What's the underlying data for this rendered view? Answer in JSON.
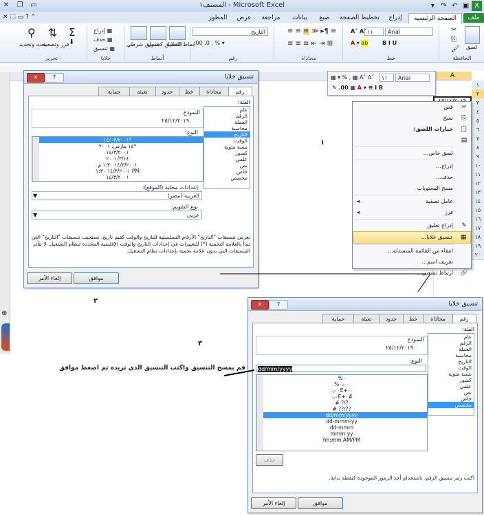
{
  "window": {
    "title": "المصنف١ - Microsoft Excel",
    "qat_icons": [
      "excel-logo-icon",
      "save-icon",
      "undo-icon",
      "redo-icon",
      "customize-icon"
    ],
    "controls": [
      "minimize-icon",
      "restore-icon",
      "close-icon"
    ]
  },
  "ribbon_tabs": {
    "file": "ملف",
    "home": "الصفحة الرئيسية",
    "insert": "إدراج",
    "page_layout": "تخطيط الصفحة",
    "formulas": "صيغ",
    "data": "بيانات",
    "review": "مراجعة",
    "view": "عرض",
    "developer": "المطور"
  },
  "ribbon": {
    "clipboard_label": "الحافظة",
    "paste": "لصق",
    "font_label": "خط",
    "font_name": "Arial",
    "font_size": "١١",
    "alignment_label": "محاذاة",
    "number_label": "رقم",
    "number_format": "التاريخ",
    "styles_label": "أنماط",
    "conditional": "تنسيق شرطي",
    "format_table": "التنسيق كجدول",
    "cell_styles": "أنماط الخلايا",
    "cells_label": "خلايا",
    "insert_cell": "إدراج",
    "delete_cell": "حذف",
    "format_cell": "تنسيق",
    "editing_label": "تحرير",
    "sort_filter": "فرز وتصفية",
    "find_select": "بحث وتحديد"
  },
  "sheet": {
    "column_a": "A",
    "selected_value": "٢٥/١٢/٢٠١٩",
    "row_numbers": [
      "١",
      "٢",
      "٣",
      "٤",
      "٥",
      "٦",
      "٧",
      "٨",
      "٩",
      "١٠",
      "١١",
      "١٢",
      "١٣",
      "١٤",
      "١٥",
      "١٦",
      "١٧",
      "١٨",
      "١٩",
      "٢٠"
    ]
  },
  "mini_toolbar": {
    "font": "Arial",
    "size": "١١"
  },
  "context_menu": {
    "items": [
      {
        "label": "قص",
        "icon": "scissors-icon"
      },
      {
        "label": "نسخ",
        "icon": "copy-icon"
      },
      {
        "label": "خيارات اللصق:",
        "icon": "paste-icon",
        "bold": true
      },
      {
        "label": "",
        "icon": "paste-values-icon"
      },
      {
        "label": "لصق خاص...",
        "icon": ""
      },
      {
        "label": "إدراج...",
        "icon": ""
      },
      {
        "label": "حذف...",
        "icon": ""
      },
      {
        "label": "مسح المحتويات",
        "icon": ""
      },
      {
        "label": "عامل تصفية",
        "icon": "",
        "arrow": true
      },
      {
        "label": "فرز",
        "icon": "",
        "arrow": true
      },
      {
        "label": "إدراج تعليق",
        "icon": "comment-icon"
      },
      {
        "label": "تنسيق خلايا...",
        "icon": "format-cells-icon",
        "highlight": true
      },
      {
        "label": "انتقاء من القائمة المنسدلة...",
        "icon": ""
      },
      {
        "label": "تعريف اسم...",
        "icon": ""
      },
      {
        "label": "ارتباط تشعبي...",
        "icon": "hyperlink-icon"
      }
    ]
  },
  "annotations": {
    "step1": "١",
    "step2": "٢",
    "step3": "٣",
    "instruction": "قم بمسح التنسيق واكتب التنسيق الذي تريده ثم اضغط موافق"
  },
  "dialog1": {
    "title": "تنسيق خلايا",
    "tabs": [
      "رقم",
      "محاذاة",
      "خط",
      "حدود",
      "تعبئة",
      "حماية"
    ],
    "category_label": "الفئة:",
    "categories": [
      "عام",
      "الرقم",
      "العملة",
      "محاسبة",
      "التاريخ",
      "الوقت",
      "نسبة مئوية",
      "كسور",
      "علمي",
      "نص",
      "خاص",
      "مخصص"
    ],
    "selected_category": 4,
    "sample_label": "النموذج",
    "sample_value": "٢٥/١٢/٢٠١٩",
    "type_label": "النوع:",
    "types": [
      "١٤/٠٣/٢٠٠١*",
      "١٤ مارس، ٢٠٠١*",
      "١٤/٣/٢٠٠١",
      "٢٠٠١/٣/١٤",
      "١٤/٣/٢٠٠١ ١:٣٠ م",
      "١٤/٣/٢٠٠١ ١:٣٠ PM",
      "١٤/٣/٢٠٠١"
    ],
    "selected_type": 0,
    "locale_label": "إعدادات محلية (الموقع):",
    "locale_value": "العربية (مصر)",
    "calendar_label": "نوع التقويم:",
    "calendar_value": "عربي",
    "description": "تعرض تنسيقات \"التاريخ\" الأرقام التسلسلية للتاريخ والوقت كقيم تاريخ. تستجيب تنسيقات \"التاريخ\" التي تبدأ بالعلامة النجمية (*) للتغييرات في إعدادات التاريخ والوقت الإقليمية المحددة لنظام التشغيل. لا تتأثر التنسيقات التي بدون علامة نجمية بإعدادات نظام التشغيل.",
    "ok": "موافق",
    "cancel": "إلغاء الأمر"
  },
  "dialog2": {
    "title": "تنسيق خلايا",
    "tabs": [
      "رقم",
      "محاذاة",
      "خط",
      "حدود",
      "تعبئة",
      "حماية"
    ],
    "category_label": "الفئة:",
    "categories": [
      "عام",
      "الرقم",
      "العملة",
      "محاسبة",
      "التاريخ",
      "الوقت",
      "نسبة مئوية",
      "كسور",
      "علمي",
      "نص",
      "خاص",
      "مخصص"
    ],
    "selected_category": 11,
    "sample_label": "النموذج",
    "sample_value": "٢٥/١٢/٢٠١٩",
    "type_label": "النوع:",
    "type_value": "dd/mm/yyyy",
    "types": [
      "%٠",
      "%٠٫٠٠",
      "٠٫٠٠E+٠٠",
      "٠٫٠E+٠#",
      "# ?/?",
      "# ??/??",
      "dd/mm/yyyy",
      "dd-mmm-yy",
      "dd-mmm",
      "mmm yy",
      "hh:mm AM/PM"
    ],
    "selected_type": 6,
    "delete": "حذف",
    "description": "اكتب رمز تنسيق الرقم، باستخدام أحد الرموز الموجودة كنقطة بداية.",
    "ok": "موافق",
    "cancel": "إلغاء الأمر"
  },
  "colors": {
    "accent_green": "#2a8d3a",
    "selection_blue": "#3399ff",
    "close_red": "#c9463d",
    "menu_highlight": "#f8de7f"
  }
}
